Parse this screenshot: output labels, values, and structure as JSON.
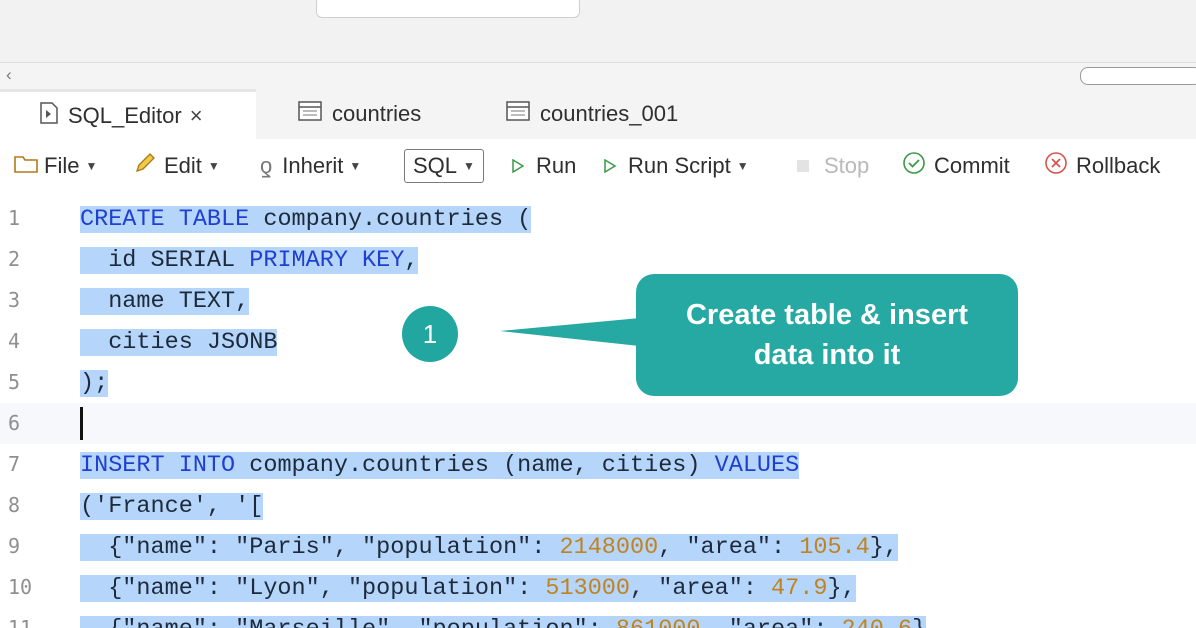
{
  "tabs": [
    {
      "label": "SQL_Editor",
      "close": "×",
      "active": true
    },
    {
      "label": "countries",
      "active": false
    },
    {
      "label": "countries_001",
      "active": false
    }
  ],
  "toolbar": {
    "file": "File",
    "edit": "Edit",
    "inherit": "Inherit",
    "sql": "SQL",
    "run": "Run",
    "run_script": "Run Script",
    "stop": "Stop",
    "commit": "Commit",
    "rollback": "Rollback"
  },
  "editor": {
    "lines": [
      {
        "n": "1",
        "tokens": [
          {
            "t": "CREATE TABLE",
            "c": "kw"
          },
          {
            "t": " company.countries ("
          }
        ]
      },
      {
        "n": "2",
        "tokens": [
          {
            "t": "  id SERIAL "
          },
          {
            "t": "PRIMARY KEY",
            "c": "kw"
          },
          {
            "t": ","
          }
        ]
      },
      {
        "n": "3",
        "tokens": [
          {
            "t": "  name TEXT,"
          }
        ]
      },
      {
        "n": "4",
        "tokens": [
          {
            "t": "  cities JSONB"
          }
        ]
      },
      {
        "n": "5",
        "tokens": [
          {
            "t": ");"
          }
        ]
      },
      {
        "n": "6",
        "tokens": [],
        "current": true
      },
      {
        "n": "7",
        "tokens": [
          {
            "t": "INSERT INTO",
            "c": "kw"
          },
          {
            "t": " company.countries (name, cities) "
          },
          {
            "t": "VALUES",
            "c": "kw"
          }
        ]
      },
      {
        "n": "8",
        "tokens": [
          {
            "t": "('France', '["
          }
        ]
      },
      {
        "n": "9",
        "tokens": [
          {
            "t": "  {\"name\": \"Paris\", \"population\": "
          },
          {
            "t": "2148000",
            "c": "num"
          },
          {
            "t": ", \"area\": "
          },
          {
            "t": "105.4",
            "c": "num"
          },
          {
            "t": "},"
          }
        ]
      },
      {
        "n": "10",
        "tokens": [
          {
            "t": "  {\"name\": \"Lyon\", \"population\": "
          },
          {
            "t": "513000",
            "c": "num"
          },
          {
            "t": ", \"area\": "
          },
          {
            "t": "47.9",
            "c": "num"
          },
          {
            "t": "},"
          }
        ]
      },
      {
        "n": "11",
        "tokens": [
          {
            "t": "  {\"name\": \"Marseille\", \"population\": "
          },
          {
            "t": "861000",
            "c": "num"
          },
          {
            "t": ", \"area\": "
          },
          {
            "t": "240.6",
            "c": "num"
          },
          {
            "t": "}"
          }
        ]
      }
    ]
  },
  "annotation": {
    "badge": "1",
    "text": "Create table & insert data into it"
  },
  "colors": {
    "keyword": "#1f3fd1",
    "number": "#c0831f",
    "selection": "#b5d5fb",
    "callout": "#26a9a2"
  }
}
